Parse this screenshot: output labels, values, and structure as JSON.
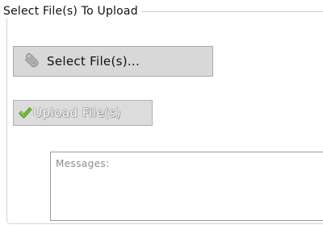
{
  "panel": {
    "legend": "Select File(s) To Upload"
  },
  "buttons": {
    "select_label": "Select File(s)...",
    "select_icon": "paperclip-icon",
    "upload_label": "Upload File(s)",
    "upload_icon": "checkmark-icon"
  },
  "messages": {
    "label": "Messages:"
  },
  "colors": {
    "button_bg": "#d8d8d8",
    "check_green": "#6fbf2a",
    "border": "#a9a9a9"
  }
}
